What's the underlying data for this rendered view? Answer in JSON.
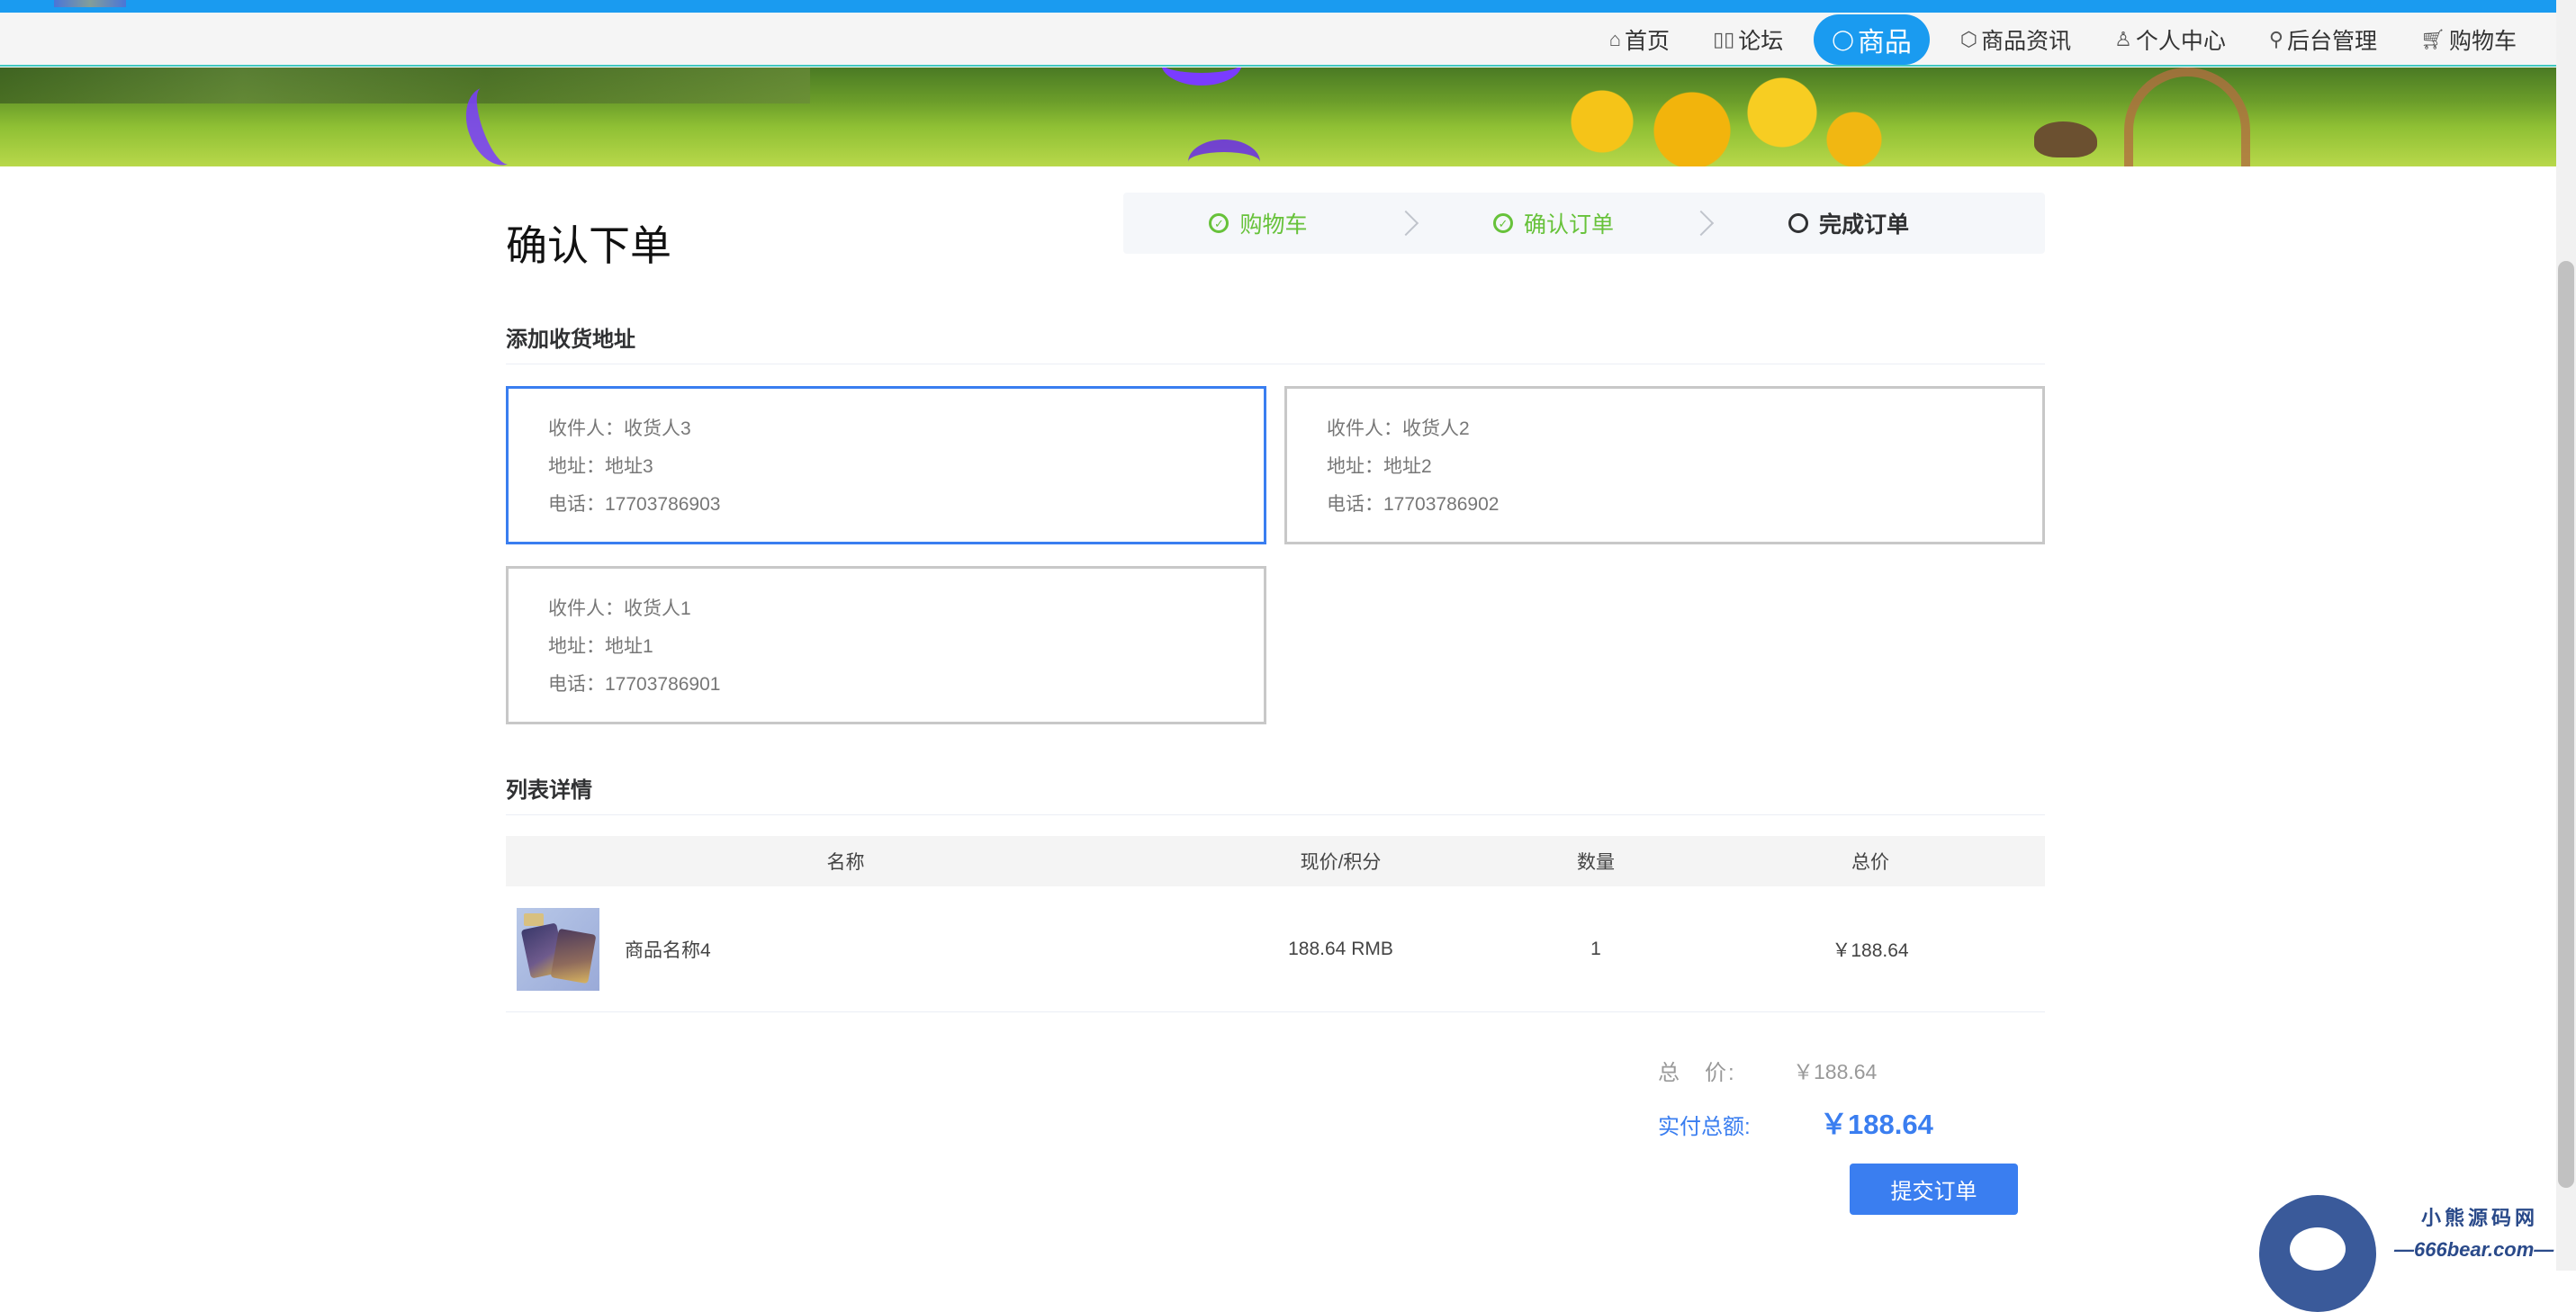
{
  "nav": {
    "items": [
      {
        "label": "首页",
        "icon": "⌂",
        "icon_name": "home-icon",
        "active": false
      },
      {
        "label": "论坛",
        "icon": "▯▯",
        "icon_name": "forum-icon",
        "active": false
      },
      {
        "label": "商品",
        "icon": "◯",
        "icon_name": "goods-icon",
        "active": true
      },
      {
        "label": "商品资讯",
        "icon": "⬡",
        "icon_name": "news-icon",
        "active": false
      },
      {
        "label": "个人中心",
        "icon": "♙",
        "icon_name": "user-icon",
        "active": false
      },
      {
        "label": "后台管理",
        "icon": "⚲",
        "icon_name": "link-icon",
        "active": false
      },
      {
        "label": "购物车",
        "icon": "🛒︎",
        "icon_name": "cart-icon",
        "active": false
      }
    ],
    "accent_color": "#1a9bf0"
  },
  "page": {
    "title": "确认下单"
  },
  "steps": [
    {
      "label": "购物车",
      "icon": "✓",
      "status": "done"
    },
    {
      "label": "确认订单",
      "icon": "✓",
      "status": "done"
    },
    {
      "label": "完成订单",
      "icon": "",
      "status": "current"
    }
  ],
  "address_section": {
    "title": "添加收货地址",
    "cards": [
      {
        "recipient": "收件人：收货人3",
        "address": "地址：地址3",
        "phone": "电话：17703786903",
        "selected": true
      },
      {
        "recipient": "收件人：收货人2",
        "address": "地址：地址2",
        "phone": "电话：17703786902",
        "selected": false
      },
      {
        "recipient": "收件人：收货人1",
        "address": "地址：地址1",
        "phone": "电话：17703786901",
        "selected": false
      }
    ]
  },
  "list_section": {
    "title": "列表详情",
    "columns": [
      "名称",
      "现价/积分",
      "数量",
      "总价"
    ],
    "rows": [
      {
        "name": "商品名称4",
        "price": "188.64 RMB",
        "qty": "1",
        "total": "￥188.64"
      }
    ]
  },
  "summary": {
    "total_label": "总　价:",
    "total_value": "￥188.64",
    "pay_label": "实付总额:",
    "pay_value": "￥188.64",
    "submit_label": "提交订单"
  },
  "watermark": {
    "line1": "小熊源码网",
    "line2": "—666bear.com—"
  },
  "colors": {
    "primary": "#3a7ef0",
    "success": "#67c23a"
  }
}
